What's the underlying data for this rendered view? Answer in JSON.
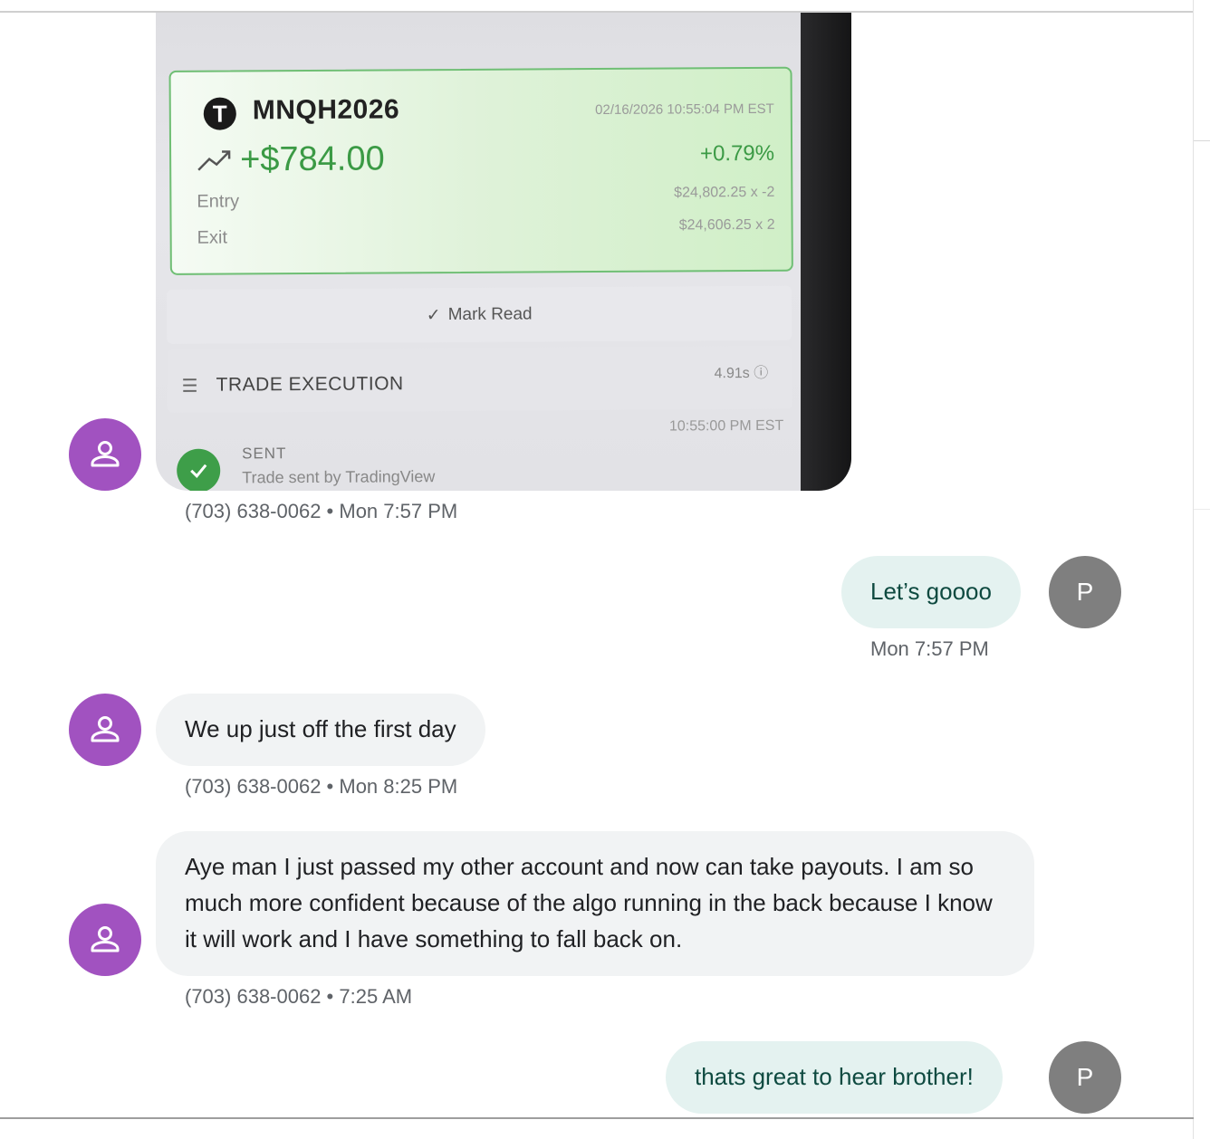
{
  "photo": {
    "ticker": "MNQH2026",
    "timestamp": "02/16/2026 10:55:04 PM EST",
    "pnl": "+$784.00",
    "pct": "+0.79%",
    "entry_label": "Entry",
    "exit_label": "Exit",
    "entry_value": "$24,802.25 x -2",
    "exit_value": "$24,606.25 x 2",
    "mark_read": "Mark Read",
    "trade_execution": "TRADE EXECUTION",
    "duration": "4.91s",
    "sent_label": "SENT",
    "sent_sub": "Trade sent by TradingView",
    "sent_time": "10:55:00 PM EST",
    "accent_green": "#3b9a45"
  },
  "messages": [
    {
      "type": "image",
      "meta": "(703) 638-0062 • Mon 7:57 PM"
    },
    {
      "type": "text",
      "direction": "outgoing",
      "text": "Let’s goooo",
      "meta": "Mon 7:57 PM",
      "avatar": "P"
    },
    {
      "type": "text",
      "direction": "incoming",
      "text": "We up just off the first day",
      "meta": "(703) 638-0062 • Mon 8:25 PM"
    },
    {
      "type": "text",
      "direction": "incoming",
      "text": "Aye man I just passed my other account and now can take payouts. I am so much more confident because of the algo running in the back because I know it will work and I have something to fall back on.",
      "meta": "(703) 638-0062 • 7:25 AM"
    },
    {
      "type": "text",
      "direction": "outgoing",
      "text": "thats great to hear brother!",
      "avatar": "P"
    }
  ],
  "colors": {
    "contact_avatar": "#a152c0",
    "self_avatar": "#7f7f7f",
    "incoming_bubble": "#f1f3f4",
    "outgoing_bubble": "#e4f2f0",
    "outgoing_text": "#0e4a40"
  },
  "icons": {
    "contact_avatar": "person-icon",
    "trend": "trending-up-icon",
    "check": "check-icon",
    "checklist": "checklist-icon",
    "info": "info-icon"
  }
}
